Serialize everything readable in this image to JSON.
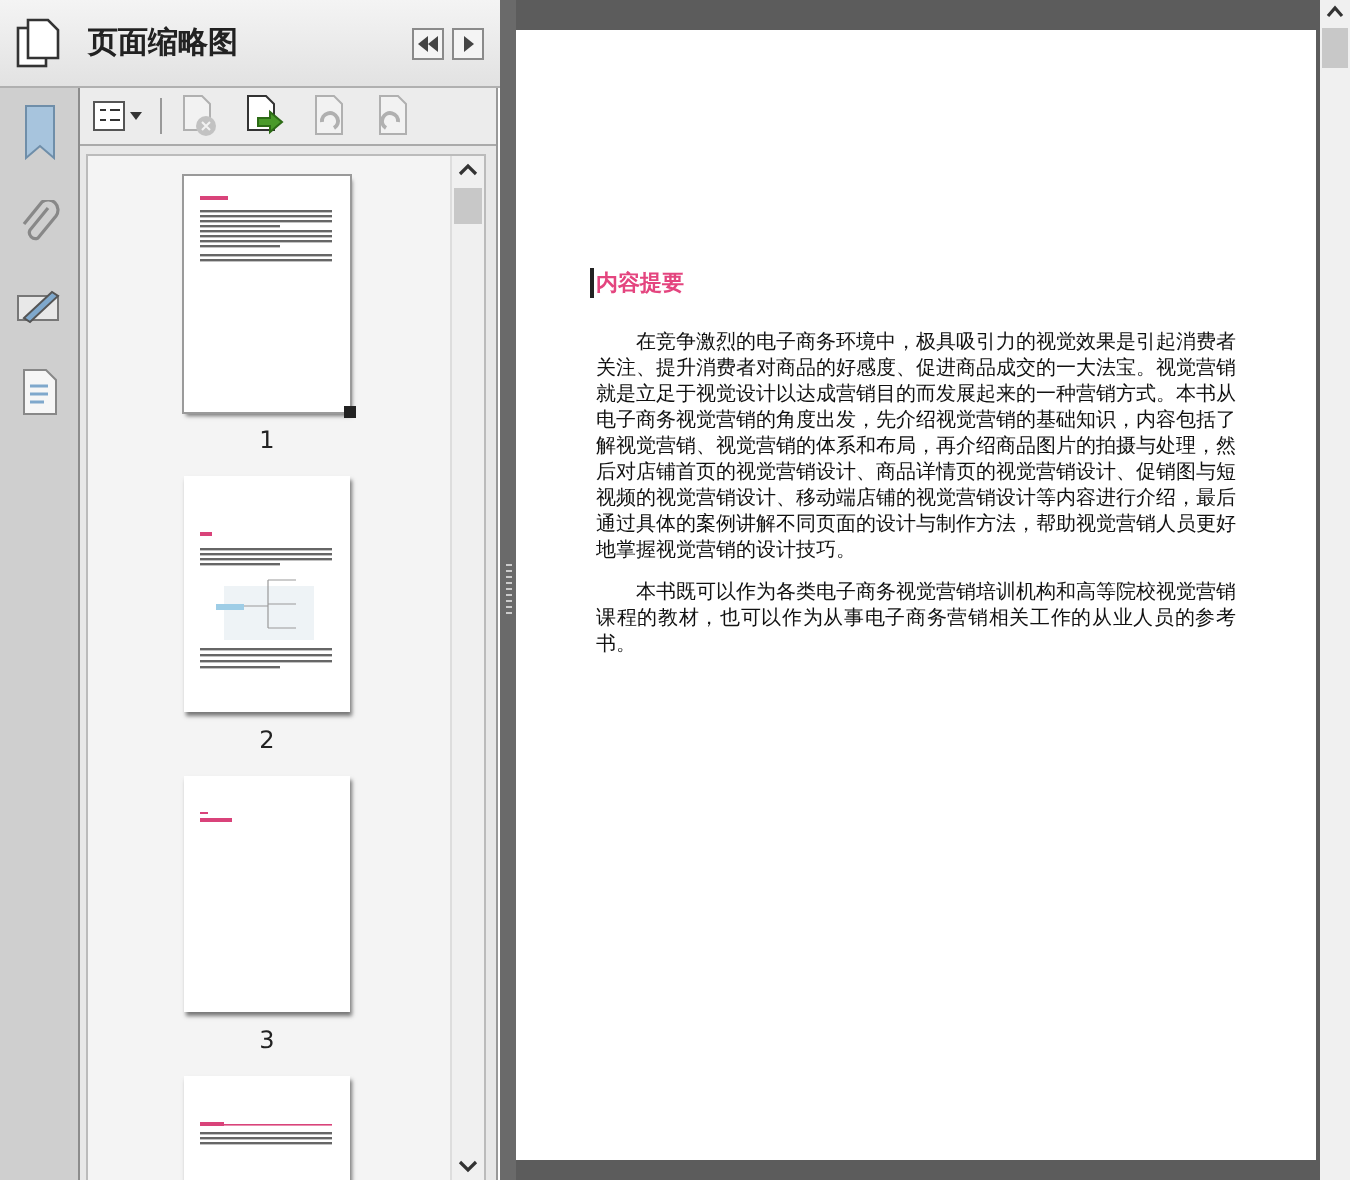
{
  "panel": {
    "title": "页面缩略图"
  },
  "tools": [
    {
      "kind": "options",
      "disabled": false
    },
    {
      "kind": "delete",
      "disabled": true
    },
    {
      "kind": "insert",
      "disabled": false
    },
    {
      "kind": "rotate-left",
      "disabled": true
    },
    {
      "kind": "rotate-right",
      "disabled": true
    }
  ],
  "thumbnails": [
    {
      "kind": "text",
      "label": "1",
      "selected": true
    },
    {
      "kind": "diagram",
      "label": "2",
      "selected": false
    },
    {
      "kind": "title",
      "label": "3",
      "selected": false
    },
    {
      "kind": "heading",
      "selected": false
    }
  ],
  "document": {
    "heading": "内容提要",
    "paragraphs": [
      "在竞争激烈的电子商务环境中，极具吸引力的视觉效果是引起消费者关注、提升消费者对商品的好感度、促进商品成交的一大法宝。视觉营销就是立足于视觉设计以达成营销目的而发展起来的一种营销方式。本书从电子商务视觉营销的角度出发，先介绍视觉营销的基础知识，内容包括了解视觉营销、视觉营销的体系和布局，再介绍商品图片的拍摄与处理，然后对店铺首页的视觉营销设计、商品详情页的视觉营销设计、促销图与短视频的视觉营销设计、移动端店铺的视觉营销设计等内容进行介绍，最后通过具体的案例讲解不同页面的设计与制作方法，帮助视觉营销人员更好地掌握视觉营销的设计技巧。",
      "本书既可以作为各类电子商务视觉营销培训机构和高等院校视觉营销课程的教材，也可以作为从事电子商务营销相关工作的从业人员的参考书。"
    ]
  }
}
